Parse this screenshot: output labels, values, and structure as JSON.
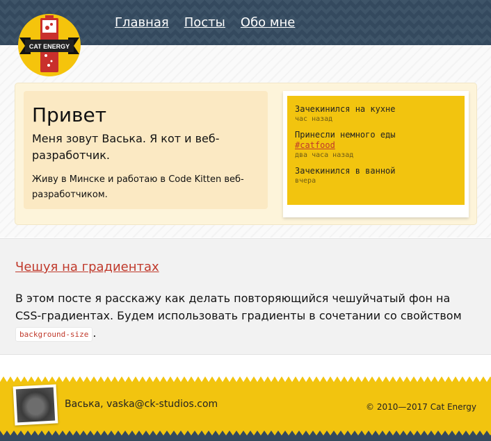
{
  "logo": {
    "text": "CAT ENERGY"
  },
  "nav": {
    "items": [
      {
        "label": "Главная"
      },
      {
        "label": "Посты"
      },
      {
        "label": "Обо мне"
      }
    ]
  },
  "intro": {
    "title": "Привет",
    "lead": "Меня зовут Васька. Я кот и веб-разработчик.",
    "sub": "Живу в Минске и работаю в Code Kitten веб-разработчиком."
  },
  "feed": {
    "items": [
      {
        "text": "Зачекинился на кухне",
        "tag": "",
        "time": "час назад"
      },
      {
        "text": "Принесли немного еды",
        "tag": "#catfood",
        "time": "два часа назад"
      },
      {
        "text": "Зачекинился в ванной",
        "tag": "",
        "time": "вчера"
      }
    ]
  },
  "post": {
    "title": "Чешуя на градиентах",
    "body": "В этом посте я расскажу как делать повторяющийся чешуйчатый фон на CSS-градиентах. Будем использовать градиенты в сочетании со свойством",
    "code": "background-size",
    "end": "."
  },
  "footer": {
    "author": "Васька, vaska@ck-studios.com",
    "copyright": "© 2010—2017 Cat Energy"
  },
  "colors": {
    "header": "#34495e",
    "accent": "#f2c40f",
    "link": "#c0392b"
  }
}
